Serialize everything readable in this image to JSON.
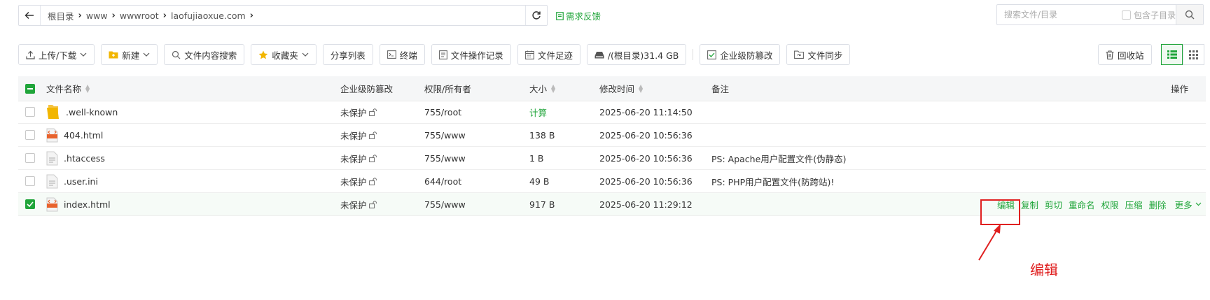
{
  "path": {
    "crumbs": [
      "根目录",
      "www",
      "wwwroot",
      "laofujiaoxue.com"
    ]
  },
  "feedback_label": "需求反馈",
  "search": {
    "placeholder": "搜索文件/目录",
    "include_subdir_label": "包含子目录"
  },
  "toolbar": {
    "upload": "上传/下载",
    "new": "新建",
    "content_search": "文件内容搜索",
    "favorites": "收藏夹",
    "share_list": "分享列表",
    "terminal": "终端",
    "op_log": "文件操作记录",
    "footprint": "文件足迹",
    "disk": "/(根目录)31.4 GB",
    "tamper": "企业级防篡改",
    "sync": "文件同步",
    "recycle": "回收站"
  },
  "table": {
    "headers": {
      "name": "文件名称",
      "tamper": "企业级防篡改",
      "perm": "权限/所有者",
      "size": "大小",
      "mtime": "修改时间",
      "note": "备注",
      "ops": "操作"
    },
    "rows": [
      {
        "name": ".well-known",
        "type": "folder",
        "tamper": "未保护",
        "perm": "755/root",
        "size": "计算",
        "mtime": "2025-06-20 11:14:50",
        "note": "",
        "checked": false
      },
      {
        "name": "404.html",
        "type": "html",
        "tamper": "未保护",
        "perm": "755/www",
        "size": "138 B",
        "mtime": "2025-06-20 10:56:36",
        "note": "",
        "checked": false
      },
      {
        "name": ".htaccess",
        "type": "file",
        "tamper": "未保护",
        "perm": "755/www",
        "size": "1 B",
        "mtime": "2025-06-20 10:56:36",
        "note": "PS: Apache用户配置文件(伪静态)",
        "checked": false
      },
      {
        "name": ".user.ini",
        "type": "file",
        "tamper": "未保护",
        "perm": "644/root",
        "size": "49 B",
        "mtime": "2025-06-20 10:56:36",
        "note": "PS: PHP用户配置文件(防跨站)!",
        "checked": false
      },
      {
        "name": "index.html",
        "type": "html",
        "tamper": "未保护",
        "perm": "755/www",
        "size": "917 B",
        "mtime": "2025-06-20 11:29:12",
        "note": "",
        "checked": true
      }
    ],
    "row_actions": [
      "编辑",
      "复制",
      "剪切",
      "重命名",
      "权限",
      "压缩",
      "删除"
    ],
    "more_label": "更多"
  },
  "annotation_label": "编辑",
  "colors": {
    "accent": "#20a53a",
    "highlight": "#e02020"
  }
}
